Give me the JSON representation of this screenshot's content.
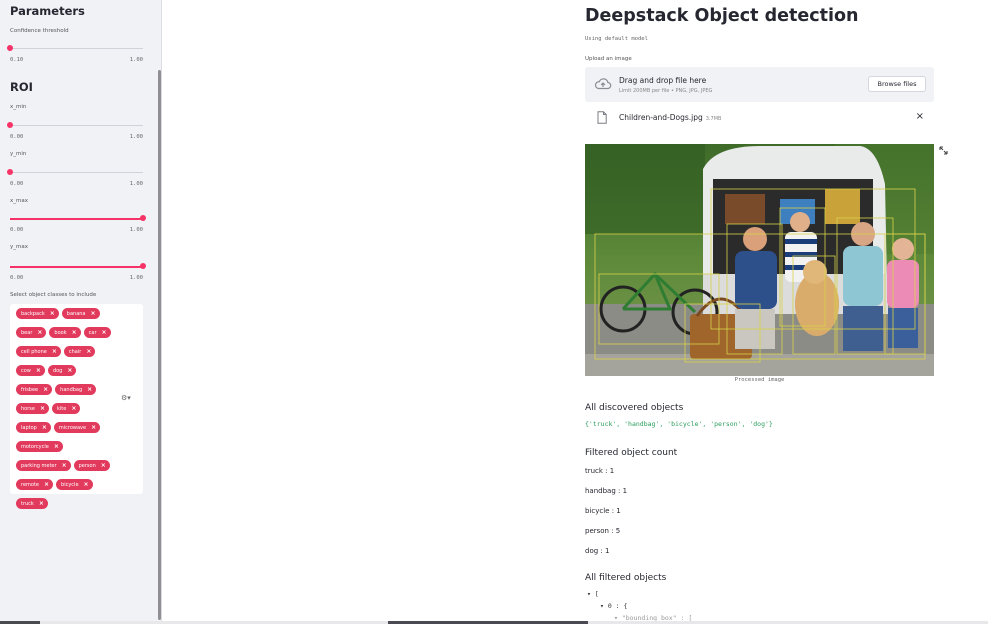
{
  "sidebar": {
    "parameters_heading": "Parameters",
    "confidence": {
      "label": "Confidence threshold",
      "value": 0.1,
      "min": "0.10",
      "max": "1.00"
    },
    "roi_heading": "ROI",
    "x_min": {
      "label": "x_min",
      "value": 0.0,
      "min": "0.00",
      "max": "1.00"
    },
    "y_min": {
      "label": "y_min",
      "value": 0.0,
      "min": "0.00",
      "max": "1.00"
    },
    "x_max": {
      "label": "x_max",
      "value": 1.0,
      "min": "0.00",
      "max": "1.00"
    },
    "y_max": {
      "label": "y_max",
      "value": 1.0,
      "min": "0.00",
      "max": "1.00"
    },
    "classes_label": "Select object classes to include",
    "classes": [
      "backpack",
      "banana",
      "bear",
      "book",
      "car",
      "cell phone",
      "chair",
      "cow",
      "dog",
      "frisbee",
      "handbag",
      "horse",
      "kite",
      "laptop",
      "microwave",
      "motorcycle",
      "parking meter",
      "person",
      "remote",
      "bicycle",
      "truck"
    ],
    "chip_close": "×"
  },
  "main": {
    "title": "Deepstack Object detection",
    "subtitle": "Using default model",
    "upload_label": "Upload an image",
    "upload_main": "Drag and drop file here",
    "upload_sub": "Limit 200MB per file • PNG, JPG, JPEG",
    "browse_label": "Browse files",
    "file_name": "Children-and-Dogs.jpg",
    "file_size": "3.7MB",
    "file_remove": "×",
    "image_caption": "Processed image",
    "discovered_heading": "All discovered objects",
    "discovered_code": "{'truck', 'handbag', 'bicycle', 'person', 'dog'}",
    "filtered_count_heading": "Filtered object count",
    "counts": [
      "truck : 1",
      "handbag : 1",
      "bicycle : 1",
      "person : 5",
      "dog : 1"
    ],
    "all_filtered_heading": "All filtered objects",
    "json_lines": [
      "▾ [",
      "▾ 0 : {",
      "▾ \"bounding_box\" : ["
    ]
  },
  "colors": {
    "accent": "#f63366",
    "chip": "#e23a5c",
    "sidebar_bg": "#f0f2f6"
  },
  "icons": [
    "cloud-upload-icon",
    "file-icon",
    "close-icon",
    "expand-icon",
    "gear-icon"
  ]
}
